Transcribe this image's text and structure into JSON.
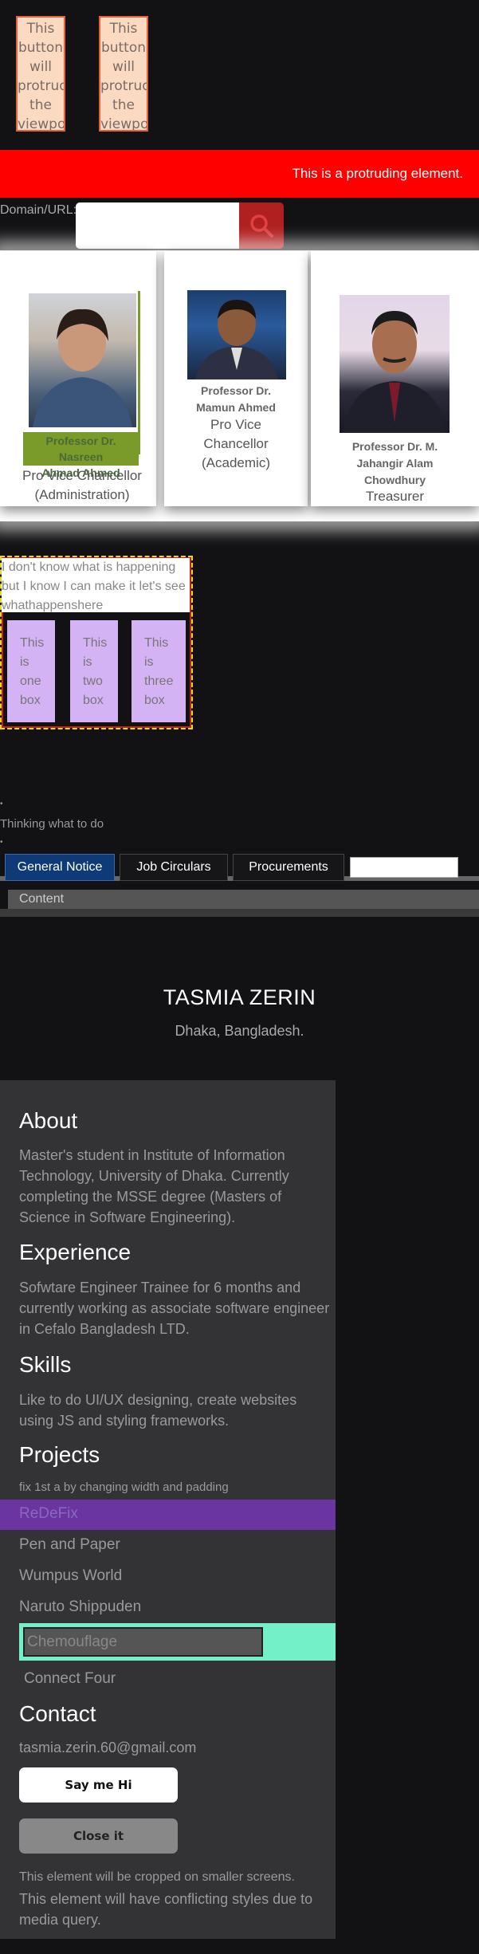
{
  "protruding_buttons": {
    "button1": [
      "This",
      "button",
      "will",
      "protrude",
      "the",
      "viewport"
    ],
    "button2": [
      "This",
      "button",
      "will",
      "protrude",
      "the",
      "viewport"
    ]
  },
  "protruding_bar": {
    "text": "This is a protruding element."
  },
  "search": {
    "label": "Domain/URL:",
    "value": "",
    "button_icon": "search-icon"
  },
  "profiles": [
    {
      "name_lines": [
        "Professor Dr. Nasreen",
        "Ahmad Ahmed"
      ],
      "role_lines": [
        "Pro Vice Chancellor",
        "(Administration)"
      ]
    },
    {
      "name_lines": [
        "Professor Dr.",
        "Mamun Ahmed"
      ],
      "role_lines": [
        "Pro Vice",
        "Chancellor",
        "(Academic)"
      ]
    },
    {
      "name_lines": [
        "Professor Dr. M.",
        "Jahangir Alam",
        "Chowdhury"
      ],
      "role_lines": [
        "Treasurer"
      ]
    }
  ],
  "dashed_section": {
    "text": "I don't know what is happening but I know I can make it let's see whathappenshere",
    "boxes": [
      [
        "This",
        "is",
        "one",
        "box"
      ],
      [
        "This",
        "is",
        "two",
        "box"
      ],
      [
        "This",
        "is",
        "three",
        "box"
      ]
    ]
  },
  "list": {
    "item": "Thinking what to do"
  },
  "tabs": {
    "items": [
      "General Notice",
      "Job Circulars",
      "Procurements"
    ],
    "active": "General Notice",
    "search_value": "",
    "content_label": "Content"
  },
  "hero": {
    "name": "TASMIA ZERIN",
    "location": "Dhaka, Bangladesh."
  },
  "about": {
    "heading": "About",
    "text": "Master's student in Institute of Information Technology, University of Dhaka. Currently completing the MSSE degree (Masters of Science in Software Engineering)."
  },
  "experience": {
    "heading": "Experience",
    "text": "Sofwtare Engineer Trainee for 6 months and currently working as associate software engineer in Cefalo Bangladesh LTD."
  },
  "skills": {
    "heading": "Skills",
    "text": "Like to do UI/UX designing, create websites using JS and styling frameworks."
  },
  "projects": {
    "heading": "Projects",
    "note": "fix 1st a by changing width and padding",
    "items": [
      "ReDeFix",
      "Pen and Paper",
      "Wumpus World",
      "Naruto Shippuden",
      "Chemouflage",
      "Connect Four"
    ]
  },
  "contact": {
    "heading": "Contact",
    "email": "tasmia.zerin.60@gmail.com",
    "say_hi": "Say me Hi",
    "close": "Close it",
    "note1": "This element will be cropped on smaller screens.",
    "note2": "This element will have conflicting styles due to media query."
  },
  "colors": {
    "red_bar": "#ff0000",
    "active_tab": "#0e3a78",
    "purple": "#6a35a0",
    "mint": "#73f0c8",
    "lavender": "#d4b3f5"
  }
}
